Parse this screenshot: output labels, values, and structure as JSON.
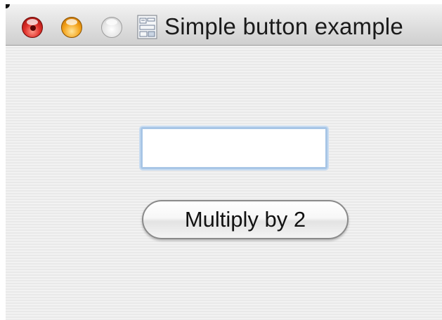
{
  "window": {
    "title": "Simple button example"
  },
  "traffic_lights": {
    "close_color": "#e0302a",
    "minimize_color": "#f4a219",
    "zoom_color": "#e2e2e2"
  },
  "form": {
    "input_value": "",
    "button_label": "Multiply by 2"
  },
  "colors": {
    "window_background": "#ececec",
    "field_focus_ring": "#a8c6e6"
  }
}
